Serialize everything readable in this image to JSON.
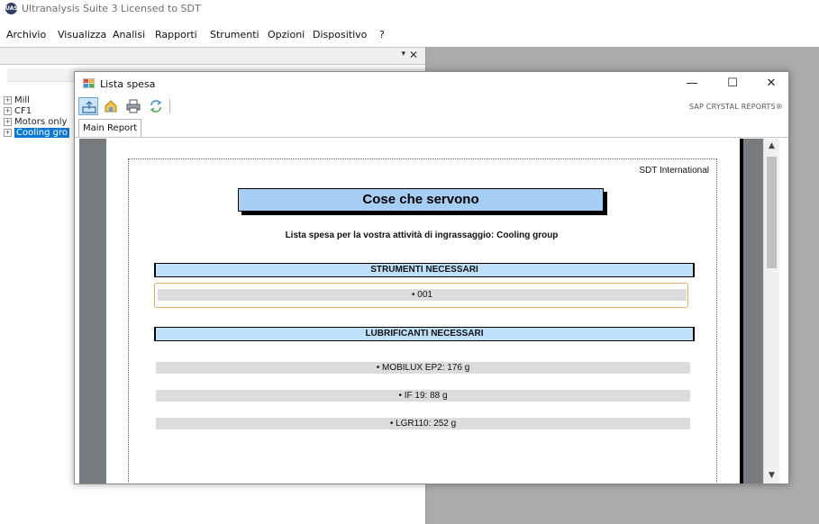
{
  "app": {
    "title": "Ultranalysis Suite 3 Licensed to SDT",
    "logo_text": "UAS",
    "menu": [
      "Archivio",
      "Visualizza",
      "Analisi",
      "Rapporti",
      "Strumenti",
      "Opzioni",
      "Dispositivo",
      "?"
    ]
  },
  "panel": {
    "pin_glyph": "▾",
    "close_glyph": "✕",
    "tree": [
      {
        "label": "Mill",
        "selected": false
      },
      {
        "label": "CF1",
        "selected": false
      },
      {
        "label": "Motors only",
        "selected": false
      },
      {
        "label": "Cooling gro",
        "selected": true
      }
    ]
  },
  "dialog": {
    "title": "Lista spesa",
    "minimize": "—",
    "maximize": "☐",
    "close": "✕",
    "brand": "SAP CRYSTAL REPORTS®",
    "tab": "Main Report"
  },
  "report": {
    "company": "SDT International",
    "title": "Cose che servono",
    "subtitle": "Lista spesa per la vostra attività di ingrassaggio: Cooling group",
    "sections": {
      "tools": {
        "heading": "STRUMENTI NECESSARI",
        "items": [
          "• 001"
        ]
      },
      "lubricants": {
        "heading": "LUBRIFICANTI NECESSARI",
        "items": [
          "• MOBILUX EP2: 176 g",
          "• IF 19: 88 g",
          "• LGR110: 252 g"
        ]
      }
    }
  },
  "scroll": {
    "up": "▲",
    "down": "▼"
  },
  "colors": {
    "title_box": "#a6cef5",
    "section_head": "#bfe0fb",
    "selection": "#0a78d7",
    "backdrop": "#ababab"
  }
}
